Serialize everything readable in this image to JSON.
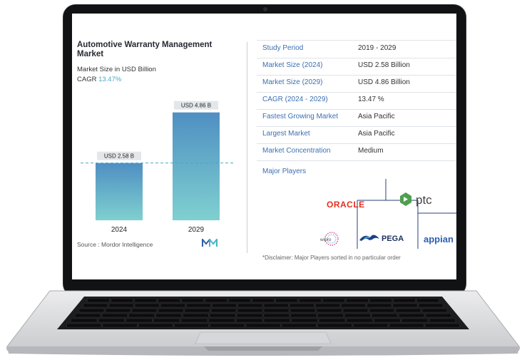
{
  "chart_data": {
    "type": "bar",
    "title": "Automotive Warranty Management Market",
    "subtitle": "Market Size in USD Billion",
    "cagr_label": "CAGR",
    "cagr_value": "13.47%",
    "categories": [
      "2024",
      "2029"
    ],
    "values": [
      2.58,
      4.86
    ],
    "data_labels": [
      "USD 2.58 B",
      "USD 4.86 B"
    ],
    "ylim": [
      0,
      5.3
    ],
    "reference_line_value": 2.58,
    "grid": false,
    "source": "Source : Mordor Intelligence"
  },
  "summary": {
    "rows": [
      {
        "label": "Study Period",
        "value": "2019 - 2029"
      },
      {
        "label": "Market Size (2024)",
        "value": "USD 2.58 Billion"
      },
      {
        "label": "Market Size (2029)",
        "value": "USD 4.86 Billion"
      },
      {
        "label": "CAGR (2024 - 2029)",
        "value": "13.47 %"
      },
      {
        "label": "Fastest Growing Market",
        "value": "Asia Pacific"
      },
      {
        "label": "Largest Market",
        "value": "Asia Pacific"
      },
      {
        "label": "Market Concentration",
        "value": "Medium"
      }
    ],
    "major_players_label": "Major Players",
    "players": [
      "ORACLE",
      "ptc",
      "wipro",
      "PEGA",
      "appian"
    ],
    "disclaimer": "*Disclaimer: Major Players sorted in no particular order"
  },
  "colors": {
    "bar_top": "#4f8fc2",
    "bar_bottom": "#7fd0d0",
    "label_bg": "#e4e7ea",
    "row_label": "#3d6fb0",
    "cagr": "#4aa8c8",
    "oracle": "#e0321f",
    "ptc": "#4d9f4f",
    "pega": "#1b3f8a",
    "appian": "#2a5fb0"
  }
}
